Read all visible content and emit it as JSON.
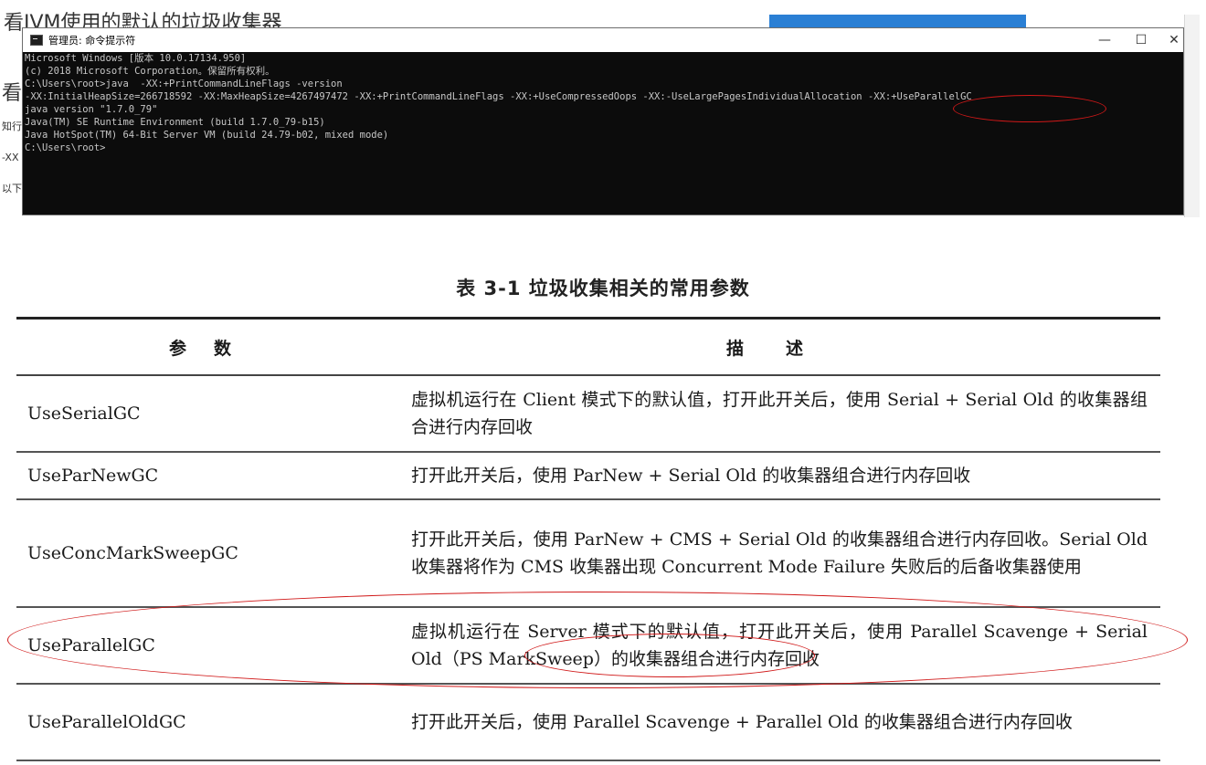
{
  "background": {
    "heading_fragment": "看JVM使用的默认的垃圾收集器",
    "frag_2": "看",
    "frag_3": "知行",
    "frag_4": "-XX",
    "frag_5": "以下"
  },
  "cmd_window": {
    "title": "管理员: 命令提示符",
    "buttons": {
      "minimize": "—",
      "maximize": "☐",
      "close": "✕"
    },
    "lines": [
      "Microsoft Windows [版本 10.0.17134.950]",
      "(c) 2018 Microsoft Corporation。保留所有权利。",
      "",
      "C:\\Users\\root>java  -XX:+PrintCommandLineFlags -version",
      "-XX:InitialHeapSize=266718592 -XX:MaxHeapSize=4267497472 -XX:+PrintCommandLineFlags -XX:+UseCompressedOops -XX:-UseLargePagesIndividualAllocation -XX:+UseParallelGC",
      "java version \"1.7.0_79\"",
      "Java(TM) SE Runtime Environment (build 1.7.0_79-b15)",
      "Java HotSpot(TM) 64-Bit Server VM (build 24.79-b02, mixed mode)",
      "",
      "C:\\Users\\root>"
    ]
  },
  "table": {
    "caption": "表 3-1   垃圾收集相关的常用参数",
    "header": {
      "param": "参数",
      "desc": "描述"
    },
    "rows": [
      {
        "param": "UseSerialGC",
        "desc": "虚拟机运行在 Client 模式下的默认值，打开此开关后，使用 Serial + Serial Old 的收集器组合进行内存回收"
      },
      {
        "param": "UseParNewGC",
        "desc": "打开此开关后，使用 ParNew + Serial Old 的收集器组合进行内存回收"
      },
      {
        "param": "UseConcMarkSweepGC",
        "desc": "打开此开关后，使用 ParNew + CMS + Serial Old 的收集器组合进行内存回收。Serial Old 收集器将作为 CMS 收集器出现 Concurrent Mode Failure 失败后的后备收集器使用"
      },
      {
        "param": "UseParallelGC",
        "desc": "虚拟机运行在 Server 模式下的默认值，打开此开关后，使用 Parallel Scavenge + Serial Old（PS MarkSweep）的收集器组合进行内存回收"
      },
      {
        "param": "UseParallelOldGC",
        "desc": "打开此开关后，使用 Parallel Scavenge + Parallel Old 的收集器组合进行内存回收"
      }
    ]
  },
  "colors": {
    "annotation_red": "#d01818",
    "console_bg": "#0c0c0c",
    "console_text": "#c7c7c7"
  }
}
